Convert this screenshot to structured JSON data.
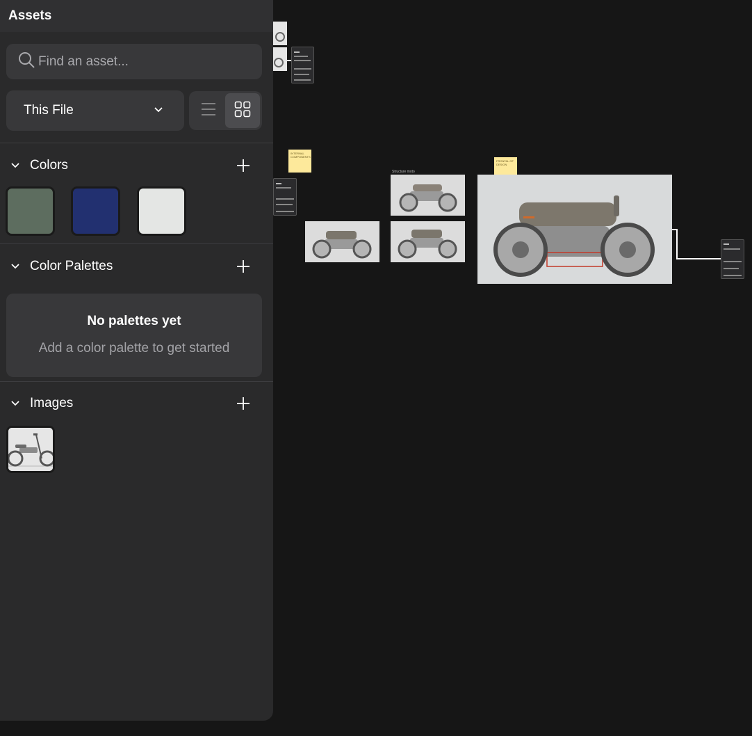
{
  "panel": {
    "title": "Assets",
    "search": {
      "placeholder": "Find an asset..."
    },
    "scope": {
      "label": "This File"
    },
    "view_toggle": {
      "list_icon": "list-icon",
      "grid_icon": "grid-icon",
      "active": "grid"
    },
    "sections": {
      "colors": {
        "label": "Colors",
        "swatches": [
          "#5d6d5f",
          "#223070",
          "#e4e6e4"
        ]
      },
      "palettes": {
        "label": "Color Palettes",
        "empty_title": "No palettes yet",
        "empty_subtitle": "Add a color palette to get started"
      },
      "images": {
        "label": "Images",
        "items": [
          "motorcycle-image"
        ]
      }
    }
  },
  "canvas": {
    "sticky_notes": [
      {
        "text": "INTERNAL COMPONENTS"
      },
      {
        "text": "FRONTAL OF DESIGN"
      }
    ],
    "frame_label": "Structure moto"
  }
}
